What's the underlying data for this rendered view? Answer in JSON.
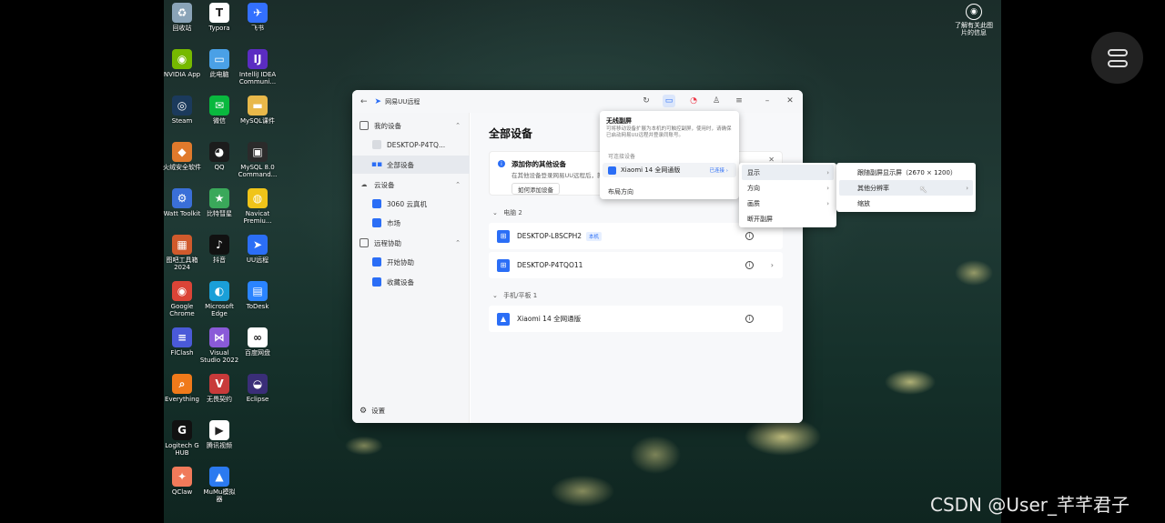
{
  "desktop": {
    "icons": [
      {
        "label": "回收站",
        "glyph": "♻",
        "color": "#8aa4b8",
        "col": 0,
        "row": 0
      },
      {
        "label": "Typora",
        "glyph": "T",
        "color": "#ffffff",
        "col": 1,
        "row": 0
      },
      {
        "label": "飞书",
        "glyph": "✈",
        "color": "#3370ff",
        "col": 2,
        "row": 0
      },
      {
        "label": "NVIDIA App",
        "glyph": "◉",
        "color": "#76b900",
        "col": 0,
        "row": 1
      },
      {
        "label": "此电脑",
        "glyph": "▭",
        "color": "#4aa0e6",
        "col": 1,
        "row": 1
      },
      {
        "label": "IntelliJ IDEA\nCommuni...",
        "glyph": "IJ",
        "color": "#5b2cc2",
        "col": 2,
        "row": 1
      },
      {
        "label": "Steam",
        "glyph": "◎",
        "color": "#1b3a5c",
        "col": 0,
        "row": 2
      },
      {
        "label": "微信",
        "glyph": "✉",
        "color": "#09b83e",
        "col": 1,
        "row": 2
      },
      {
        "label": "MySQL课件",
        "glyph": "▬",
        "color": "#e8b84a",
        "col": 2,
        "row": 2
      },
      {
        "label": "火绒安全软件",
        "glyph": "◆",
        "color": "#e07a2c",
        "col": 0,
        "row": 3
      },
      {
        "label": "QQ",
        "glyph": "◕",
        "color": "#1c1c1c",
        "col": 1,
        "row": 3
      },
      {
        "label": "MySQL 8.0\nCommand...",
        "glyph": "▣",
        "color": "#2b2b2b",
        "col": 2,
        "row": 3
      },
      {
        "label": "Watt Toolkit",
        "glyph": "⚙",
        "color": "#3a6fd8",
        "col": 0,
        "row": 4
      },
      {
        "label": "比特彗星",
        "glyph": "★",
        "color": "#3aa85a",
        "col": 1,
        "row": 4
      },
      {
        "label": "Navicat\nPremiu...",
        "glyph": "◍",
        "color": "#f0c419",
        "col": 2,
        "row": 4
      },
      {
        "label": "图吧工具箱\n2024",
        "glyph": "▦",
        "color": "#d05a2c",
        "col": 0,
        "row": 5
      },
      {
        "label": "抖音",
        "glyph": "♪",
        "color": "#111111",
        "col": 1,
        "row": 5
      },
      {
        "label": "UU远程",
        "glyph": "➤",
        "color": "#2b6ef6",
        "col": 2,
        "row": 5
      },
      {
        "label": "Google\nChrome",
        "glyph": "◉",
        "color": "#db4437",
        "col": 0,
        "row": 6
      },
      {
        "label": "Microsoft\nEdge",
        "glyph": "◐",
        "color": "#1a9fd8",
        "col": 1,
        "row": 6
      },
      {
        "label": "ToDesk",
        "glyph": "▤",
        "color": "#2a84ff",
        "col": 2,
        "row": 6
      },
      {
        "label": "FlClash",
        "glyph": "≡",
        "color": "#4a5ad8",
        "col": 0,
        "row": 7
      },
      {
        "label": "Visual\nStudio 2022",
        "glyph": "⋈",
        "color": "#8a5ad8",
        "col": 1,
        "row": 7
      },
      {
        "label": "百度网盘",
        "glyph": "∞",
        "color": "#ffffff",
        "col": 2,
        "row": 7
      },
      {
        "label": "Everything",
        "glyph": "⌕",
        "color": "#f07a1a",
        "col": 0,
        "row": 8
      },
      {
        "label": "无畏契约",
        "glyph": "V",
        "color": "#c83a3a",
        "col": 1,
        "row": 8
      },
      {
        "label": "Eclipse",
        "glyph": "◒",
        "color": "#3a2e78",
        "col": 2,
        "row": 8
      },
      {
        "label": "Logitech G\nHUB",
        "glyph": "G",
        "color": "#111111",
        "col": 0,
        "row": 9
      },
      {
        "label": "腾讯视频",
        "glyph": "▶",
        "color": "#ffffff",
        "col": 1,
        "row": 9
      },
      {
        "label": "QClaw",
        "glyph": "✦",
        "color": "#f07a5a",
        "col": 0,
        "row": 10
      },
      {
        "label": "MuMu模拟\n器",
        "glyph": "▲",
        "color": "#2b7af0",
        "col": 1,
        "row": 10
      }
    ],
    "topright_label": "了解有关此图\n片的信息",
    "watermark": "CSDN @User_芊芊君子"
  },
  "window": {
    "app_title": "网易UU远程",
    "sidebar": {
      "my_devices": "我的设备",
      "desktop_item": "DESKTOP-P4TQ...",
      "all_devices": "全部设备",
      "cloud_devices": "云设备",
      "cloud_item": "3060 云真机",
      "market": "市场",
      "remote_assist": "远程协助",
      "start_assist": "开始协助",
      "saved_devices": "收藏设备",
      "settings": "设置"
    },
    "main": {
      "title": "全部设备",
      "banner_title": "添加你的其他设备",
      "banner_sub": "在其他设备登录网易UU远程后，就",
      "banner_btn": "如何添加设备",
      "group_pc": "电脑 2",
      "pc1": "DESKTOP-L8SCPH2",
      "pc1_tag": "本机",
      "pc2": "DESKTOP-P4TQO11",
      "group_phone": "手机/平板 1",
      "phone1": "Xiaomi 14 全网通版"
    }
  },
  "popup": {
    "title": "无线副屏",
    "desc": "可将移动设备扩展为本机的可触控副屏，使用时，请确保已启动网易UU远程并登录同账号。",
    "section": "可连接设备",
    "device": "Xiaomi 14 全网通版",
    "status": "已连接",
    "layout": "布局方向"
  },
  "menu1": [
    "显示",
    "方向",
    "画质",
    "断开副屏"
  ],
  "menu2": [
    "跟随副屏显示屏（2670 × 1200）",
    "其他分辨率",
    "缩放"
  ]
}
